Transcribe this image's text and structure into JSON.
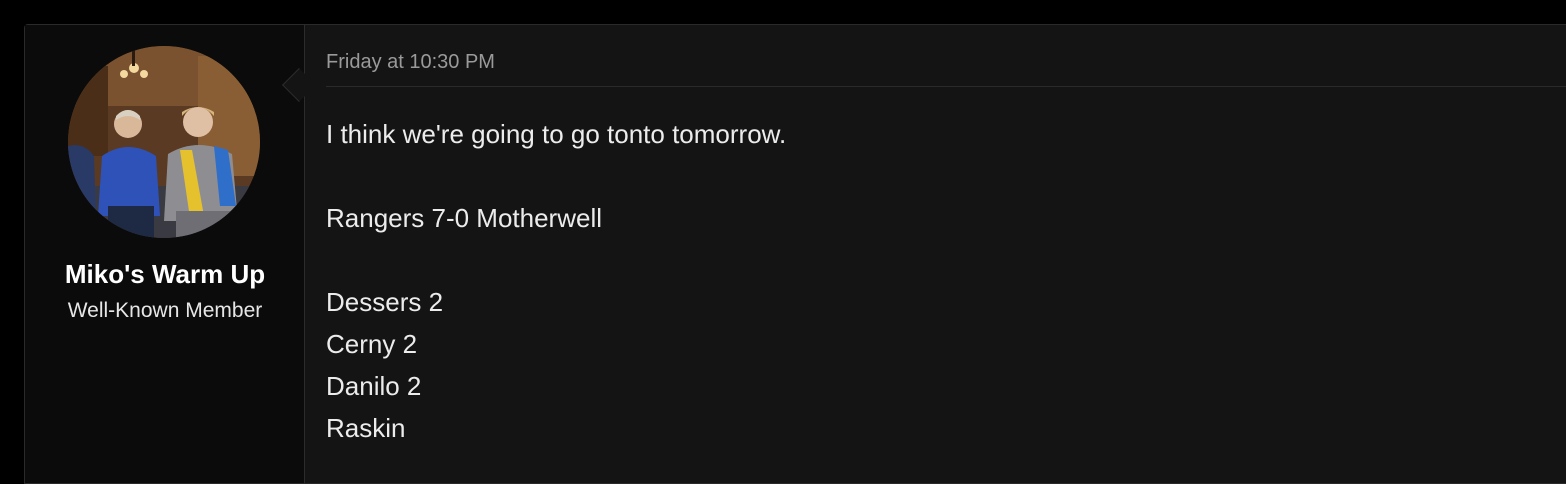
{
  "post": {
    "author": {
      "name": "Miko's Warm Up",
      "title": "Well-Known Member"
    },
    "date": "Friday at 10:30 PM",
    "body_lines": [
      "I think we're going to go tonto tomorrow.",
      "",
      "Rangers 7-0 Motherwell",
      "",
      "Dessers 2",
      "Cerny 2",
      "Danilo 2",
      "Raskin"
    ]
  },
  "colors": {
    "page_background": "#000000",
    "post_background": "#141414",
    "user_cell_background": "#0b0b0b",
    "text": "#ececec",
    "muted_text": "#9a9a9a"
  },
  "icons": {
    "avatar": "user-avatar-photo"
  }
}
